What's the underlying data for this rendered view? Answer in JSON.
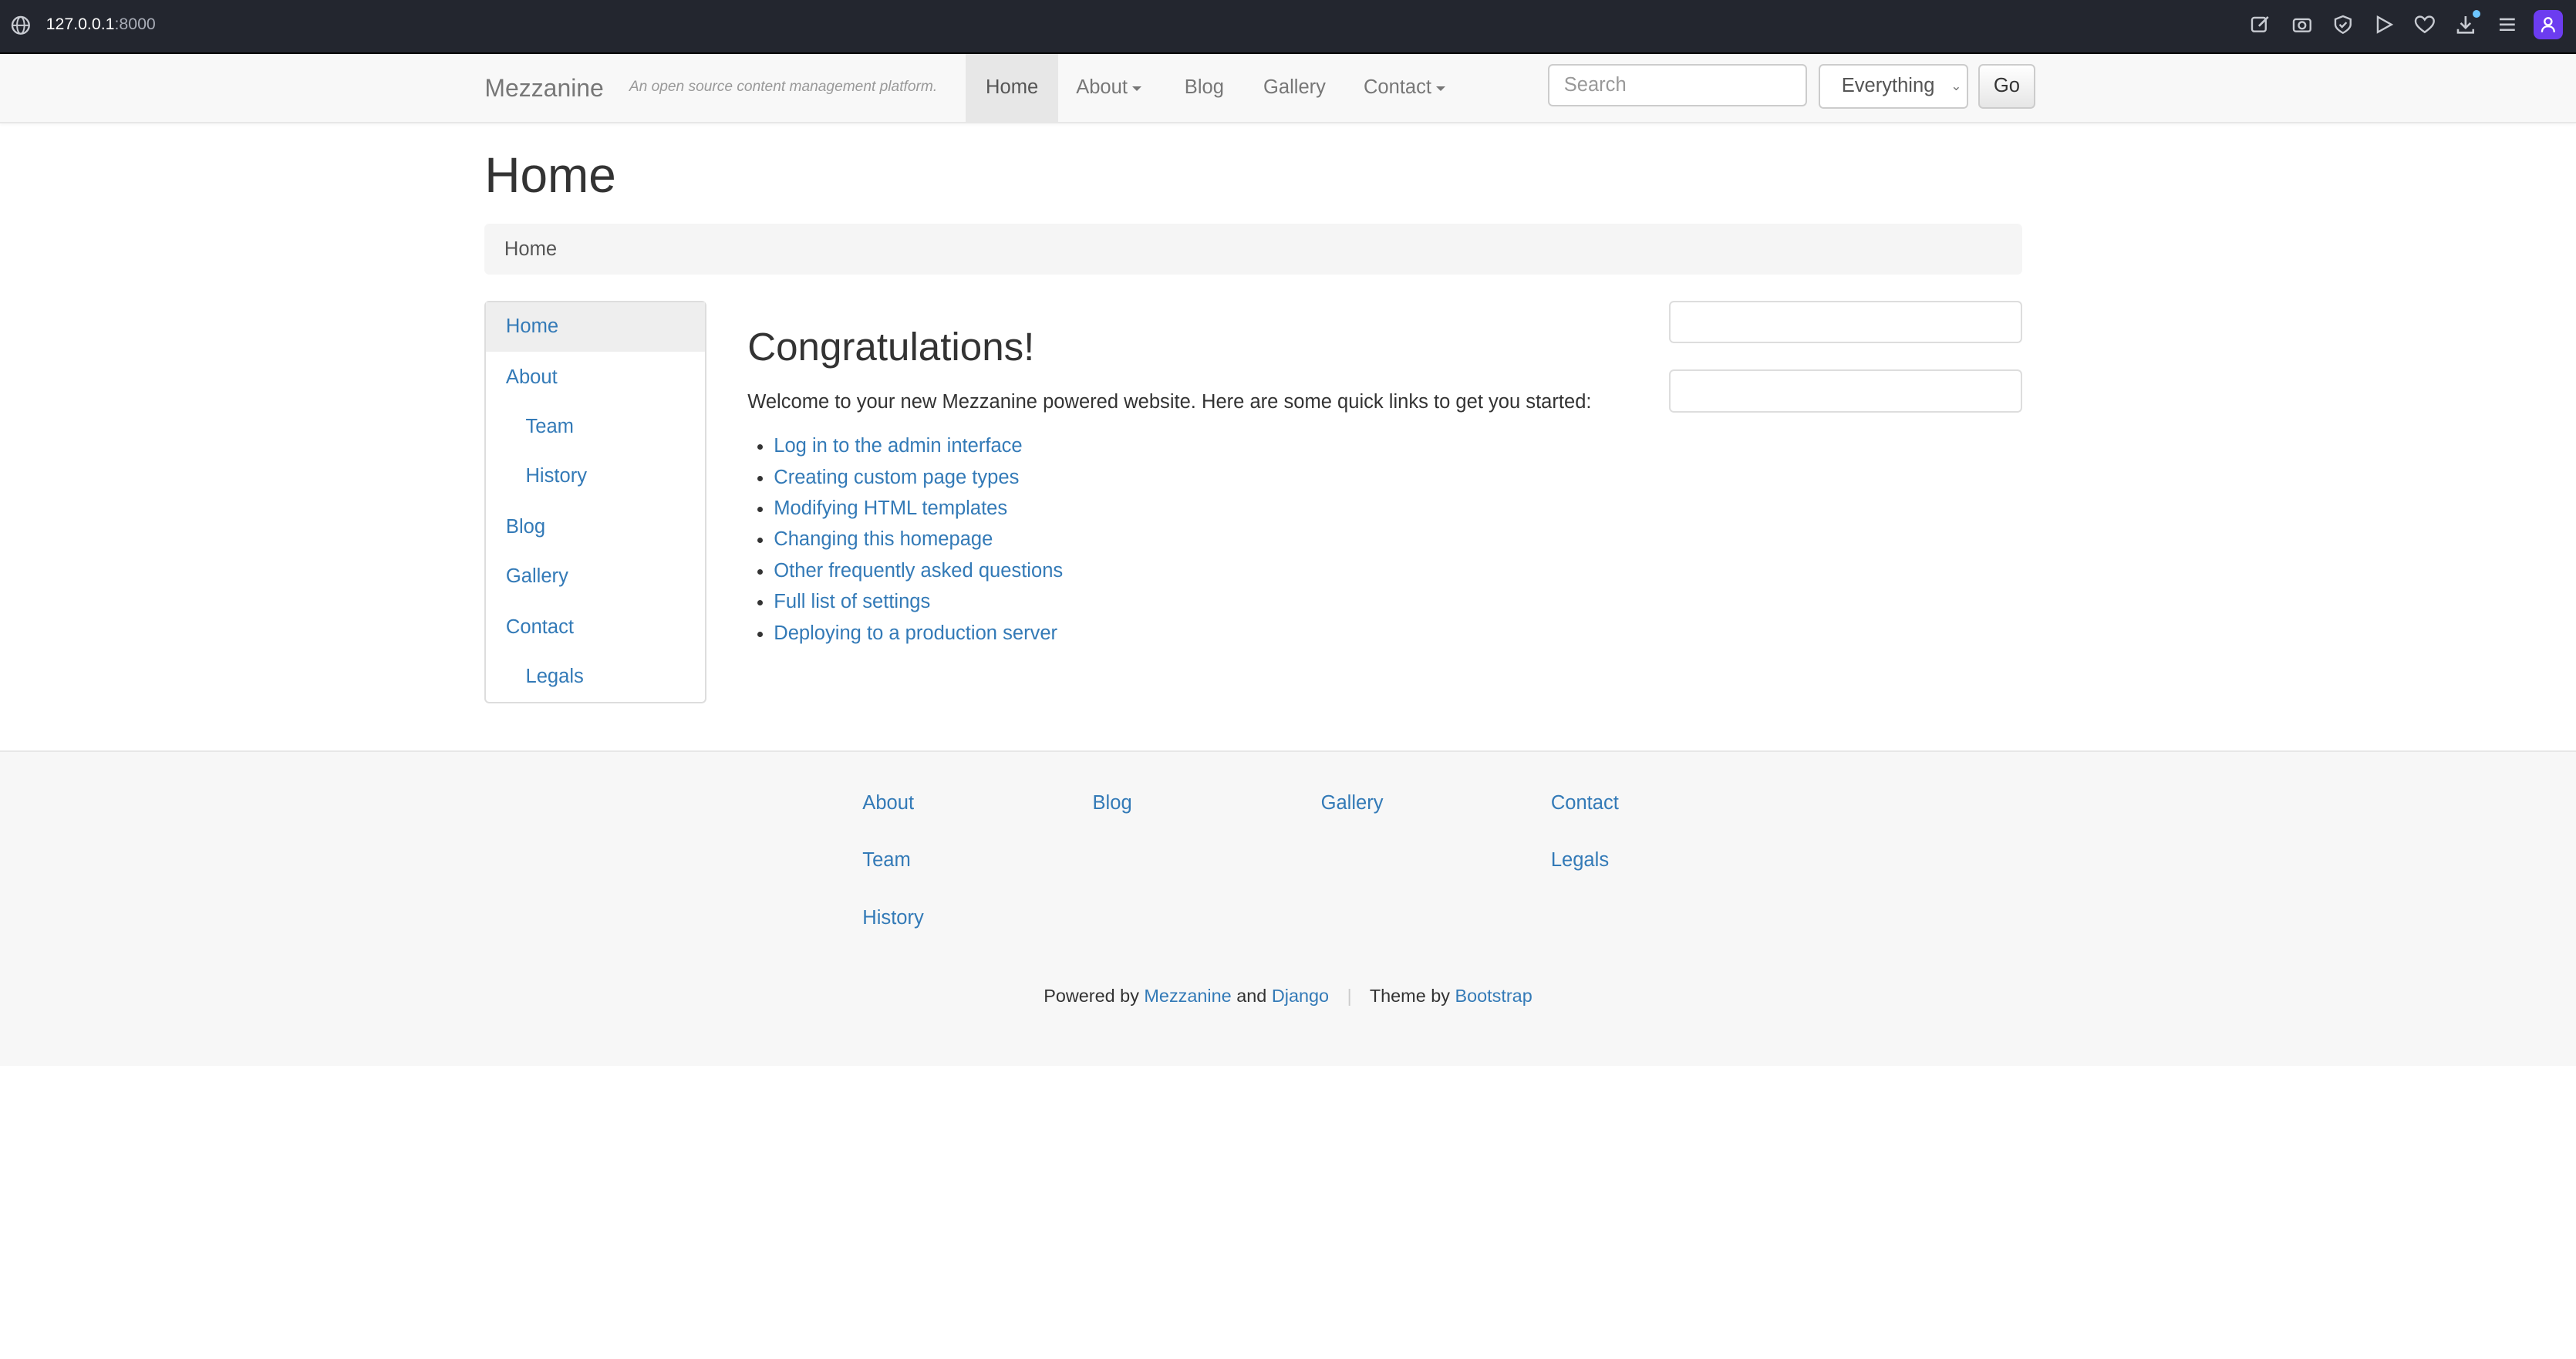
{
  "browser": {
    "url_host": "127.0.0.1",
    "url_port": ":8000",
    "toolbar_icons": [
      "edit-icon",
      "camera-icon",
      "shield-icon",
      "play-icon",
      "heart-icon",
      "download-icon",
      "menu-icon",
      "profile-icon"
    ]
  },
  "navbar": {
    "brand": "Mezzanine",
    "tagline": "An open source content management platform.",
    "items": [
      {
        "label": "Home"
      },
      {
        "label": "About"
      },
      {
        "label": "Blog"
      },
      {
        "label": "Gallery"
      },
      {
        "label": "Contact"
      }
    ],
    "search": {
      "placeholder": "Search",
      "value": ""
    },
    "search_scope": "Everything",
    "go_label": "Go"
  },
  "page": {
    "title": "Home",
    "breadcrumb": "Home"
  },
  "left_nav": {
    "items": [
      {
        "label": "Home"
      },
      {
        "label": "About"
      },
      {
        "label": "Team"
      },
      {
        "label": "History"
      },
      {
        "label": "Blog"
      },
      {
        "label": "Gallery"
      },
      {
        "label": "Contact"
      },
      {
        "label": "Legals"
      }
    ]
  },
  "main": {
    "heading": "Congratulations!",
    "intro": "Welcome to your new Mezzanine powered website. Here are some quick links to get you started:",
    "links": [
      "Log in to the admin interface",
      "Creating custom page types",
      "Modifying HTML templates",
      "Changing this homepage",
      "Other frequently asked questions",
      "Full list of settings",
      "Deploying to a production server"
    ]
  },
  "footer": {
    "columns": [
      [
        "About",
        "Team",
        "History"
      ],
      [
        "Blog"
      ],
      [
        "Gallery"
      ],
      [
        "Contact",
        "Legals"
      ]
    ],
    "powered_by": "Powered by",
    "mezzanine": "Mezzanine",
    "and": "and",
    "django": "Django",
    "theme_by": "Theme by",
    "bootstrap": "Bootstrap"
  }
}
